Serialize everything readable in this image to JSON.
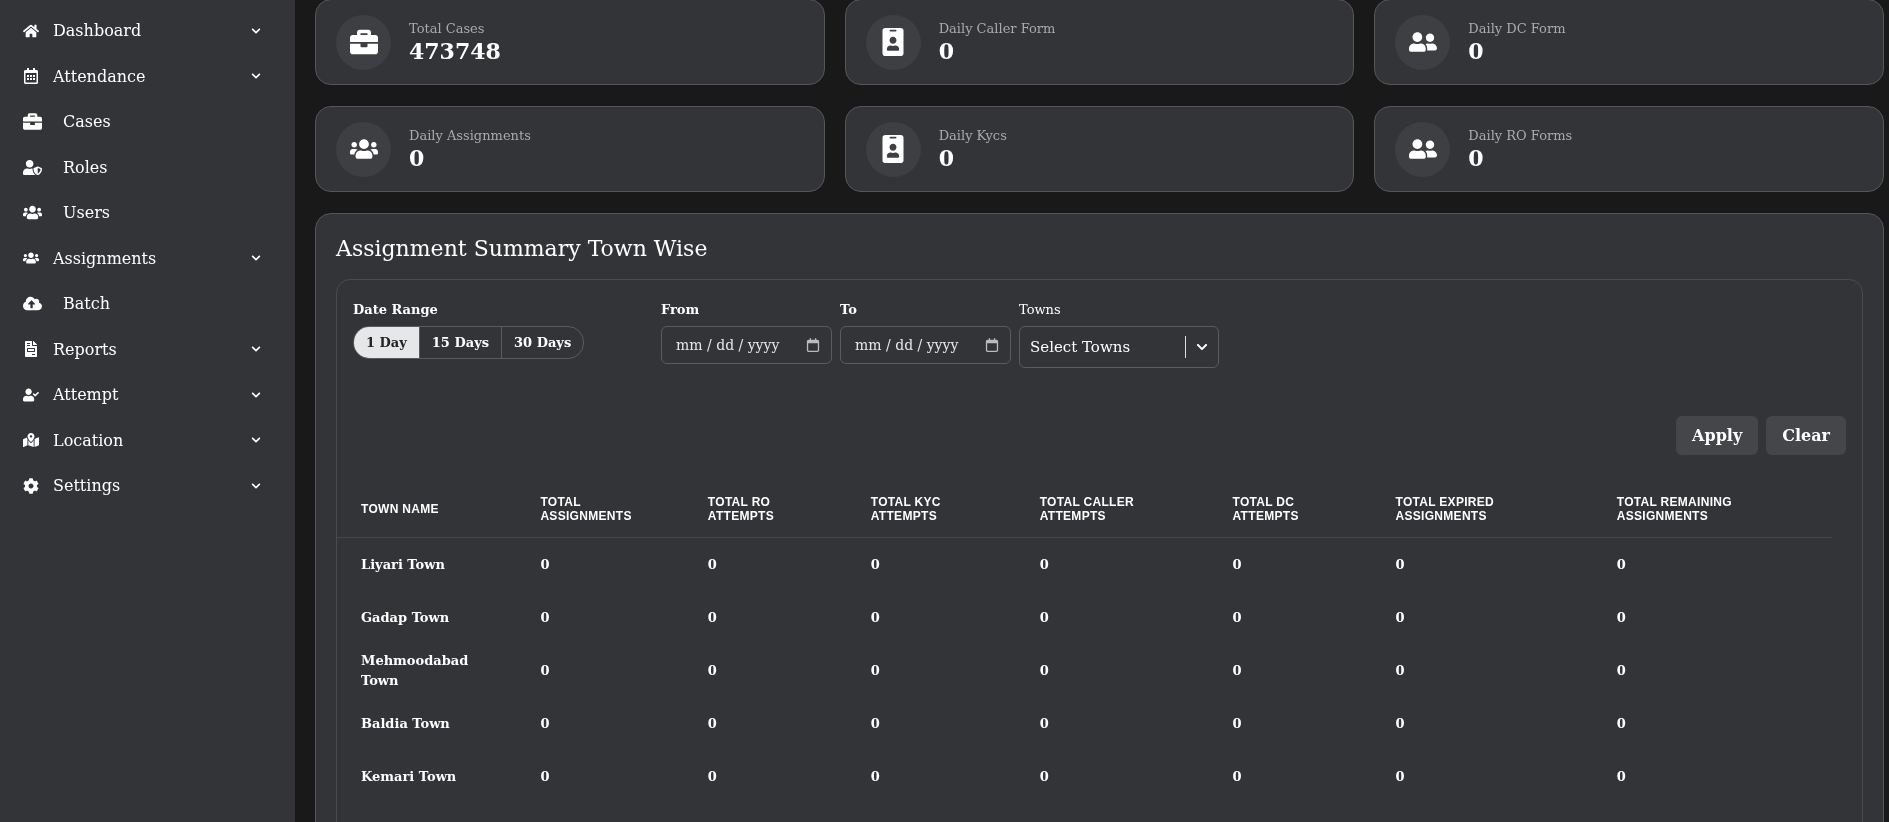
{
  "sidebar": {
    "items": [
      {
        "label": "Dashboard",
        "kind": "group"
      },
      {
        "label": "Attendance",
        "kind": "group"
      },
      {
        "label": "Cases",
        "kind": "link"
      },
      {
        "label": "Roles",
        "kind": "link"
      },
      {
        "label": "Users",
        "kind": "link"
      },
      {
        "label": "Assignments",
        "kind": "group"
      },
      {
        "label": "Batch",
        "kind": "link"
      },
      {
        "label": "Reports",
        "kind": "group"
      },
      {
        "label": "Attempt",
        "kind": "group"
      },
      {
        "label": "Location",
        "kind": "group"
      },
      {
        "label": "Settings",
        "kind": "group"
      }
    ]
  },
  "stats": [
    {
      "label": "Total Cases",
      "value": "473748"
    },
    {
      "label": "Daily Caller Form",
      "value": "0"
    },
    {
      "label": "Daily DC Form",
      "value": "0"
    },
    {
      "label": "Daily Assignments",
      "value": "0"
    },
    {
      "label": "Daily Kycs",
      "value": "0"
    },
    {
      "label": "Daily RO Forms",
      "value": "0"
    }
  ],
  "summary": {
    "title": "Assignment Summary Town Wise",
    "filters": {
      "date_range": {
        "label": "Date Range",
        "options": [
          {
            "label": "1 Day",
            "selected": true
          },
          {
            "label": "15 Days",
            "selected": false
          },
          {
            "label": "30 Days",
            "selected": false
          }
        ]
      },
      "from": {
        "label": "From",
        "placeholder": "mm / dd / yyyy"
      },
      "to": {
        "label": "To",
        "placeholder": "mm / dd / yyyy"
      },
      "towns": {
        "label": "Towns",
        "placeholder": "Select Towns"
      }
    },
    "buttons": [
      "Apply",
      "Clear"
    ],
    "table": {
      "columns": [
        "TOWN NAME",
        "TOTAL ASSIGNMENTS",
        "TOTAL RO ATTEMPTS",
        "TOTAL KYC ATTEMPTS",
        "TOTAL CALLER ATTEMPTS",
        "TOTAL DC ATTEMPTS",
        "TOTAL EXPIRED ASSIGNMENTS",
        "TOTAL REMAINING ASSIGNMENTS"
      ],
      "rows": [
        [
          "Liyari Town",
          "0",
          "0",
          "0",
          "0",
          "0",
          "0",
          "0"
        ],
        [
          "Gadap Town",
          "0",
          "0",
          "0",
          "0",
          "0",
          "0",
          "0"
        ],
        [
          "Mehmoodabad Town",
          "0",
          "0",
          "0",
          "0",
          "0",
          "0",
          "0"
        ],
        [
          "Baldia Town",
          "0",
          "0",
          "0",
          "0",
          "0",
          "0",
          "0"
        ],
        [
          "Kemari Town",
          "0",
          "0",
          "0",
          "0",
          "0",
          "0",
          "0"
        ]
      ]
    }
  }
}
